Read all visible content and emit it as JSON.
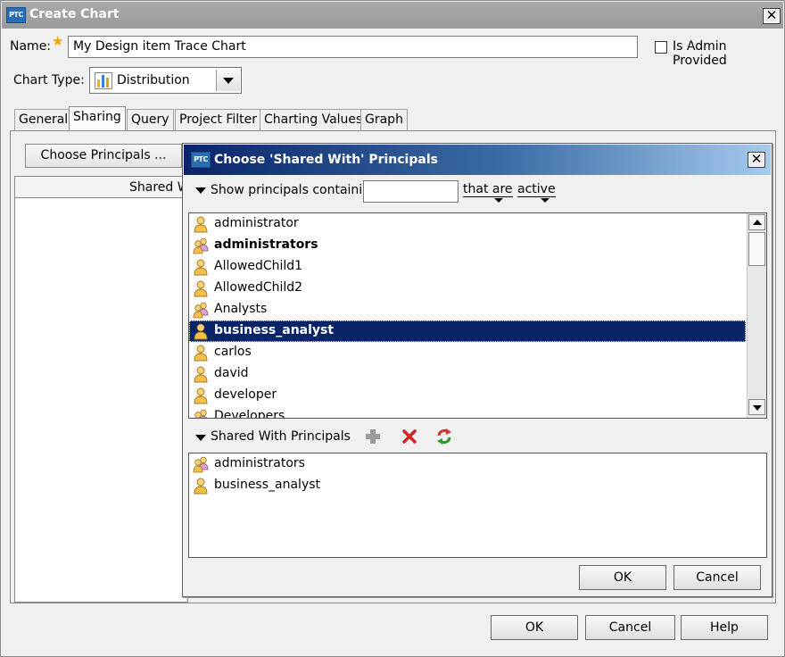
{
  "window": {
    "logo_text": "PTC",
    "title": "Create Chart",
    "close_glyph": "✕"
  },
  "form": {
    "name_label": "Name:",
    "required_star": "★",
    "name_value": "My Design item Trace Chart",
    "admin_provided_label": "Is Admin Provided",
    "admin_provided_checked": false,
    "chart_type_label": "Chart Type:",
    "chart_type_value": "Distribution",
    "chart_type_icon": "bar-chart-icon"
  },
  "tabs": [
    {
      "label": "General",
      "active": false
    },
    {
      "label": "Sharing",
      "active": true
    },
    {
      "label": "Query",
      "active": false
    },
    {
      "label": "Project Filter",
      "active": false
    },
    {
      "label": "Charting Values",
      "active": false
    },
    {
      "label": "Graph",
      "active": false
    }
  ],
  "sharing": {
    "choose_button": "Choose Principals ...",
    "shared_column_header": "Shared W"
  },
  "footer": {
    "ok": "OK",
    "cancel": "Cancel",
    "help": "Help"
  },
  "dialog": {
    "logo_text": "PTC",
    "title": "Choose 'Shared With' Principals",
    "close_glyph": "✕",
    "filter": {
      "show_label": "Show principals containing",
      "search_value": "",
      "that_are": "that are",
      "state": "active"
    },
    "principals": [
      {
        "label": "administrator",
        "kind": "user",
        "bold": false,
        "selected": false
      },
      {
        "label": "administrators",
        "kind": "group",
        "bold": true,
        "selected": false
      },
      {
        "label": "AllowedChild1",
        "kind": "user",
        "bold": false,
        "selected": false
      },
      {
        "label": "AllowedChild2",
        "kind": "user",
        "bold": false,
        "selected": false
      },
      {
        "label": "Analysts",
        "kind": "group",
        "bold": false,
        "selected": false
      },
      {
        "label": "business_analyst",
        "kind": "user",
        "bold": true,
        "selected": true
      },
      {
        "label": "carlos",
        "kind": "user",
        "bold": false,
        "selected": false
      },
      {
        "label": "david",
        "kind": "user",
        "bold": false,
        "selected": false
      },
      {
        "label": "developer",
        "kind": "user",
        "bold": false,
        "selected": false
      },
      {
        "label": "Developers",
        "kind": "group",
        "bold": false,
        "selected": false
      }
    ],
    "shared_with_label": "Shared With Principals",
    "toolbar_icons": [
      "add-icon",
      "remove-icon",
      "refresh-icon"
    ],
    "shared_with": [
      {
        "label": "administrators",
        "kind": "group"
      },
      {
        "label": "business_analyst",
        "kind": "user"
      }
    ],
    "ok": "OK",
    "cancel": "Cancel"
  },
  "colors": {
    "selection": "#0a246a",
    "dialog_title_start": "#0a246a",
    "dialog_title_end": "#a6caf0",
    "star": "#f0a000",
    "ptc_logo": "#2a6db5"
  }
}
